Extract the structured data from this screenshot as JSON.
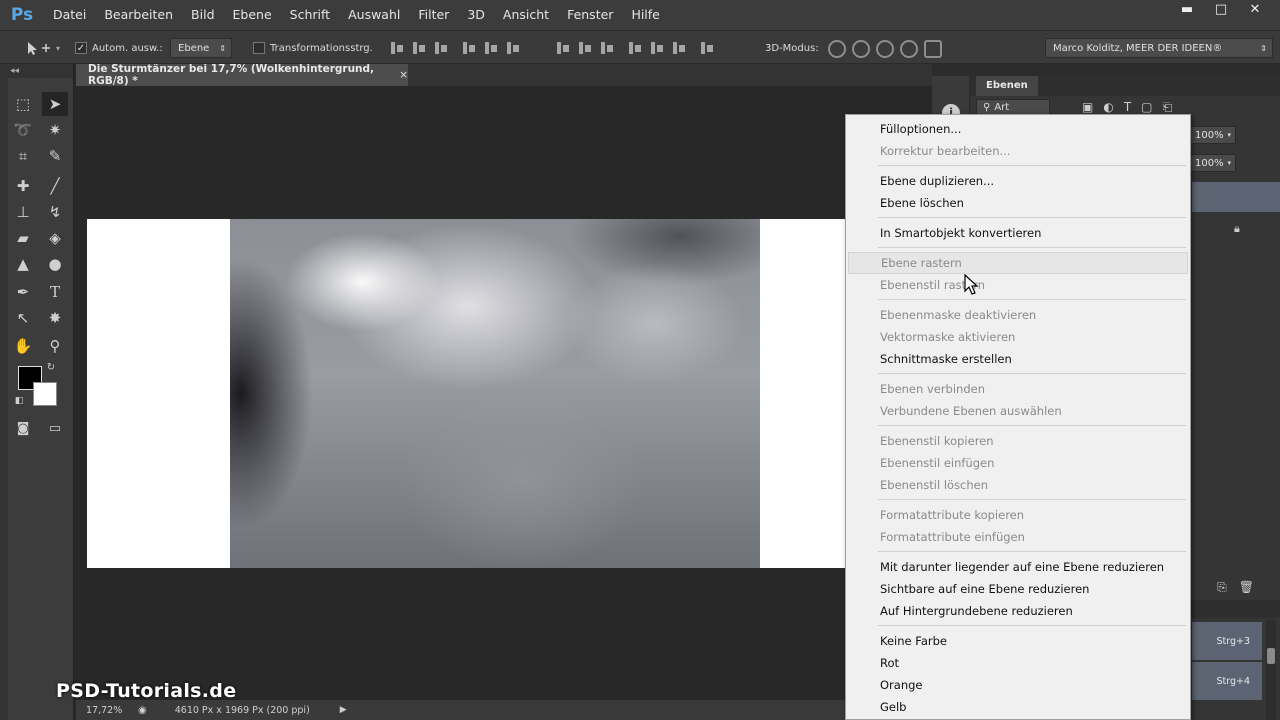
{
  "app": {
    "logo": "Ps",
    "menu": [
      "Datei",
      "Bearbeiten",
      "Bild",
      "Ebene",
      "Schrift",
      "Auswahl",
      "Filter",
      "3D",
      "Ansicht",
      "Fenster",
      "Hilfe"
    ],
    "window_controls": {
      "minimize": "▬",
      "maximize": "□",
      "close": "✕"
    }
  },
  "options_bar": {
    "auto_select_label": "Autom. ausw.:",
    "auto_select_checked": true,
    "auto_select_value": "Ebene",
    "transform_label": "Transformationsstrg.",
    "transform_checked": false,
    "mode_3d_label": "3D-Modus:",
    "workspace": "Marco Kolditz, MEER DER IDEEN®"
  },
  "document": {
    "tab_title": "Die Sturmtänzer bei 17,7% (Wolkenhintergrund, RGB/8) *",
    "tab_close": "×",
    "zoom": "17,72%",
    "doc_info": "4610 Px x 1969 Px (200 ppi)"
  },
  "watermark": "PSD-Tutorials.de",
  "layers_panel": {
    "tab": "Ebenen",
    "filter_label": "Art",
    "opacity": "100%",
    "fill": "100%"
  },
  "second_panel": {
    "shortcuts": [
      "Strg+3",
      "Strg+4"
    ]
  },
  "context_menu": {
    "groups": [
      [
        {
          "label": "Fülloptionen...",
          "enabled": true
        },
        {
          "label": "Korrektur bearbeiten...",
          "enabled": false
        }
      ],
      [
        {
          "label": "Ebene duplizieren...",
          "enabled": true
        },
        {
          "label": "Ebene löschen",
          "enabled": true
        }
      ],
      [
        {
          "label": "In Smartobjekt konvertieren",
          "enabled": true
        }
      ],
      [
        {
          "label": "Ebene rastern",
          "enabled": false,
          "hover": true
        },
        {
          "label": "Ebenenstil rastern",
          "enabled": false
        }
      ],
      [
        {
          "label": "Ebenenmaske deaktivieren",
          "enabled": false
        },
        {
          "label": "Vektormaske aktivieren",
          "enabled": false
        },
        {
          "label": "Schnittmaske erstellen",
          "enabled": true
        }
      ],
      [
        {
          "label": "Ebenen verbinden",
          "enabled": false
        },
        {
          "label": "Verbundene Ebenen auswählen",
          "enabled": false
        }
      ],
      [
        {
          "label": "Ebenenstil kopieren",
          "enabled": false
        },
        {
          "label": "Ebenenstil einfügen",
          "enabled": false
        },
        {
          "label": "Ebenenstil löschen",
          "enabled": false
        }
      ],
      [
        {
          "label": "Formatattribute kopieren",
          "enabled": false
        },
        {
          "label": "Formatattribute einfügen",
          "enabled": false
        }
      ],
      [
        {
          "label": "Mit darunter liegender auf eine Ebene reduzieren",
          "enabled": true
        },
        {
          "label": "Sichtbare auf eine Ebene reduzieren",
          "enabled": true
        },
        {
          "label": "Auf Hintergrundebene reduzieren",
          "enabled": true
        }
      ],
      [
        {
          "label": "Keine Farbe",
          "enabled": true
        },
        {
          "label": "Rot",
          "enabled": true
        },
        {
          "label": "Orange",
          "enabled": true
        },
        {
          "label": "Gelb",
          "enabled": true
        }
      ]
    ]
  },
  "colors": {
    "foreground": "#000000",
    "background": "#ffffff",
    "accent": "#5aa7e6"
  }
}
